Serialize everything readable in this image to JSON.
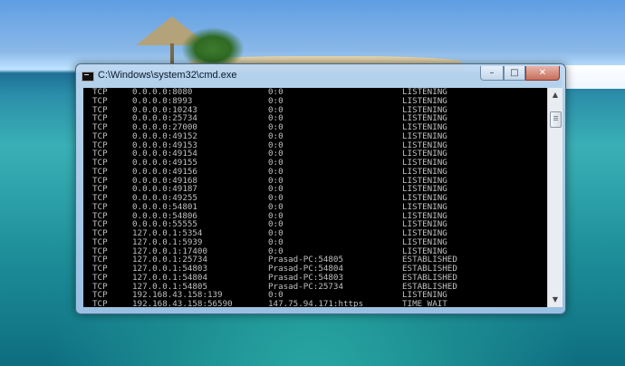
{
  "window": {
    "title": "C:\\Windows\\system32\\cmd.exe",
    "controls": {
      "minimize": "–",
      "maximize": "□",
      "close": "✕"
    }
  },
  "scrollbar": {
    "up_glyph": "▲",
    "down_glyph": "▼"
  },
  "console": {
    "rows": [
      {
        "proto": "TCP",
        "local": "0.0.0.0:8080",
        "foreign": "0:0",
        "state": "LISTENING"
      },
      {
        "proto": "TCP",
        "local": "0.0.0.0:8993",
        "foreign": "0:0",
        "state": "LISTENING"
      },
      {
        "proto": "TCP",
        "local": "0.0.0.0:10243",
        "foreign": "0:0",
        "state": "LISTENING"
      },
      {
        "proto": "TCP",
        "local": "0.0.0.0:25734",
        "foreign": "0:0",
        "state": "LISTENING"
      },
      {
        "proto": "TCP",
        "local": "0.0.0.0:27000",
        "foreign": "0:0",
        "state": "LISTENING"
      },
      {
        "proto": "TCP",
        "local": "0.0.0.0:49152",
        "foreign": "0:0",
        "state": "LISTENING"
      },
      {
        "proto": "TCP",
        "local": "0.0.0.0:49153",
        "foreign": "0:0",
        "state": "LISTENING"
      },
      {
        "proto": "TCP",
        "local": "0.0.0.0:49154",
        "foreign": "0:0",
        "state": "LISTENING"
      },
      {
        "proto": "TCP",
        "local": "0.0.0.0:49155",
        "foreign": "0:0",
        "state": "LISTENING"
      },
      {
        "proto": "TCP",
        "local": "0.0.0.0:49156",
        "foreign": "0:0",
        "state": "LISTENING"
      },
      {
        "proto": "TCP",
        "local": "0.0.0.0:49168",
        "foreign": "0:0",
        "state": "LISTENING"
      },
      {
        "proto": "TCP",
        "local": "0.0.0.0:49187",
        "foreign": "0:0",
        "state": "LISTENING"
      },
      {
        "proto": "TCP",
        "local": "0.0.0.0:49255",
        "foreign": "0:0",
        "state": "LISTENING"
      },
      {
        "proto": "TCP",
        "local": "0.0.0.0:54801",
        "foreign": "0:0",
        "state": "LISTENING"
      },
      {
        "proto": "TCP",
        "local": "0.0.0.0:54806",
        "foreign": "0:0",
        "state": "LISTENING"
      },
      {
        "proto": "TCP",
        "local": "0.0.0.0:55555",
        "foreign": "0:0",
        "state": "LISTENING"
      },
      {
        "proto": "TCP",
        "local": "127.0.0.1:5354",
        "foreign": "0:0",
        "state": "LISTENING"
      },
      {
        "proto": "TCP",
        "local": "127.0.0.1:5939",
        "foreign": "0:0",
        "state": "LISTENING"
      },
      {
        "proto": "TCP",
        "local": "127.0.0.1:17400",
        "foreign": "0:0",
        "state": "LISTENING"
      },
      {
        "proto": "TCP",
        "local": "127.0.0.1:25734",
        "foreign": "Prasad-PC:54805",
        "state": "ESTABLISHED"
      },
      {
        "proto": "TCP",
        "local": "127.0.0.1:54803",
        "foreign": "Prasad-PC:54804",
        "state": "ESTABLISHED"
      },
      {
        "proto": "TCP",
        "local": "127.0.0.1:54804",
        "foreign": "Prasad-PC:54803",
        "state": "ESTABLISHED"
      },
      {
        "proto": "TCP",
        "local": "127.0.0.1:54805",
        "foreign": "Prasad-PC:25734",
        "state": "ESTABLISHED"
      },
      {
        "proto": "TCP",
        "local": "192.168.43.158:139",
        "foreign": "0:0",
        "state": "LISTENING"
      },
      {
        "proto": "TCP",
        "local": "192.168.43.158:56590",
        "foreign": "147.75.94.171:https",
        "state": "TIME_WAIT"
      }
    ]
  }
}
